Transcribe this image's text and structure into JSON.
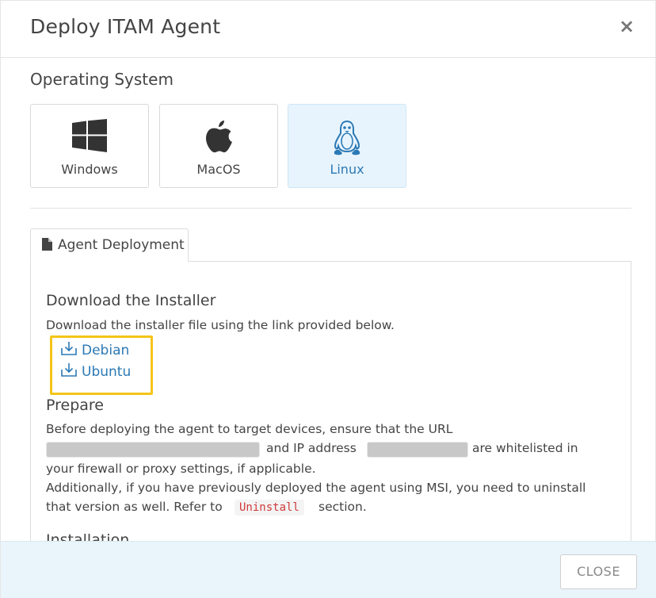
{
  "modal": {
    "title": "Deploy ITAM Agent",
    "close_symbol": "×"
  },
  "os_section": {
    "label": "Operating System",
    "options": [
      {
        "label": "Windows",
        "icon": "windows-icon",
        "selected": false
      },
      {
        "label": "MacOS",
        "icon": "apple-icon",
        "selected": false
      },
      {
        "label": "Linux",
        "icon": "linux-tux-icon",
        "selected": true
      }
    ]
  },
  "tab": {
    "label": "Agent Deployment",
    "icon": "document-icon"
  },
  "download": {
    "heading": "Download the Installer",
    "description": "Download the installer file using the link provided below.",
    "links": [
      {
        "label": "Debian",
        "icon": "download-icon"
      },
      {
        "label": "Ubuntu",
        "icon": "download-icon"
      }
    ]
  },
  "prepare": {
    "heading": "Prepare",
    "line1": "Before deploying the agent to target devices, ensure that the URL",
    "line2_mid": "and IP address",
    "line2_end": "are whitelisted in",
    "line3": "your firewall or proxy settings, if applicable.",
    "line4": "Additionally, if you have previously deployed the agent using MSI, you need to uninstall",
    "line5_start": "that version as well. Refer to",
    "line5_code": "Uninstall",
    "line5_end": "section."
  },
  "installation": {
    "heading": "Installation"
  },
  "footer": {
    "close_label": "CLOSE"
  },
  "colors": {
    "accent": "#2b79b5",
    "highlight": "#f5c518",
    "footer_bg": "#e9f5fb",
    "selected_bg": "#e8f4fd",
    "code_text": "#d03a3a"
  }
}
